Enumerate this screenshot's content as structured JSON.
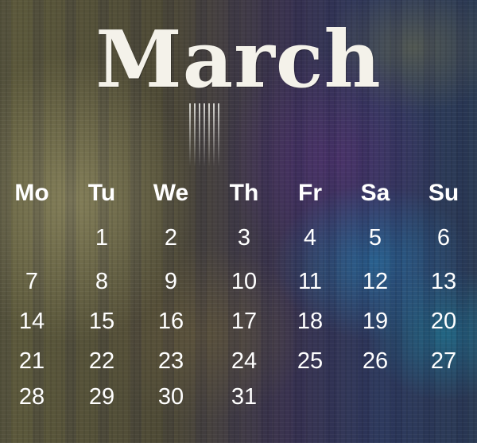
{
  "month": "March",
  "weekdays": [
    "Mo",
    "Tu",
    "We",
    "Th",
    "Fr",
    "Sa",
    "Su"
  ],
  "weeks": [
    [
      "",
      "1",
      "2",
      "3",
      "4",
      "5",
      "6"
    ],
    [
      "7",
      "8",
      "9",
      "10",
      "11",
      "12",
      "13"
    ],
    [
      "14",
      "15",
      "16",
      "17",
      "18",
      "19",
      "20"
    ],
    [
      "21",
      "22",
      "23",
      "24",
      "25",
      "26",
      "27"
    ],
    [
      "28",
      "29",
      "30",
      "31",
      "",
      "",
      ""
    ]
  ]
}
